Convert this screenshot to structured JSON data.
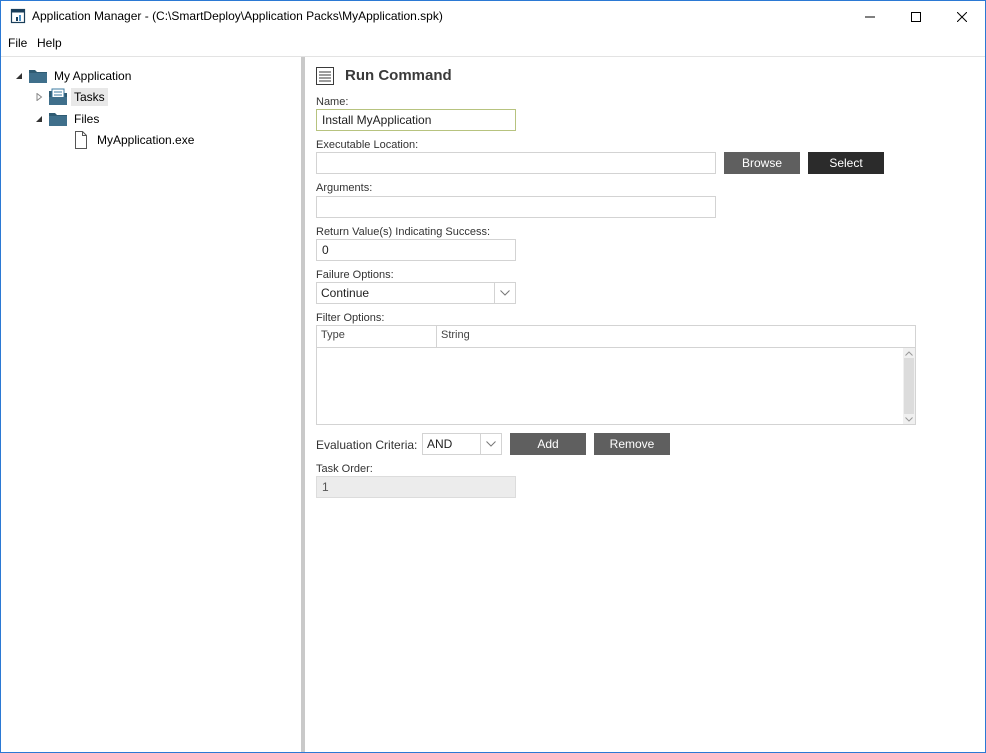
{
  "window": {
    "title": "Application Manager - (C:\\SmartDeploy\\Application Packs\\MyApplication.spk)",
    "icon": "app-window-icon",
    "controls": [
      "minimize-icon",
      "maximize-icon",
      "close-icon"
    ]
  },
  "menu": {
    "file": "File",
    "help": "Help"
  },
  "tree": {
    "root": {
      "label": "My Application",
      "icon": "folder-icon",
      "expanded": true
    },
    "tasks": {
      "label": "Tasks",
      "icon": "tasks-icon",
      "expanded": false,
      "selected": true
    },
    "files": {
      "label": "Files",
      "icon": "folder-icon",
      "expanded": true
    },
    "file_item": {
      "label": "MyApplication.exe",
      "icon": "file-icon"
    }
  },
  "panel": {
    "title": "Run Command",
    "icon": "document-lines-icon",
    "name": {
      "label": "Name:",
      "value": "Install MyApplication"
    },
    "executable": {
      "label": "Executable Location:",
      "value": "",
      "browse": "Browse",
      "select": "Select"
    },
    "arguments": {
      "label": "Arguments:",
      "value": ""
    },
    "return_values": {
      "label": "Return Value(s) Indicating Success:",
      "value": "0"
    },
    "failure": {
      "label": "Failure Options:",
      "value": "Continue"
    },
    "filter": {
      "label": "Filter Options:",
      "columns": [
        "Type",
        "String"
      ],
      "rows": []
    },
    "evaluation": {
      "label": "Evaluation Criteria:",
      "value": "AND",
      "add": "Add",
      "remove": "Remove"
    },
    "task_order": {
      "label": "Task Order:",
      "value": "1"
    }
  },
  "colors": {
    "window_border": "#2b79d4",
    "button_gray": "#5f5f5f",
    "button_dark": "#2b2b2b",
    "focus_border": "#b7c37f",
    "folder": "#2f5b73"
  }
}
